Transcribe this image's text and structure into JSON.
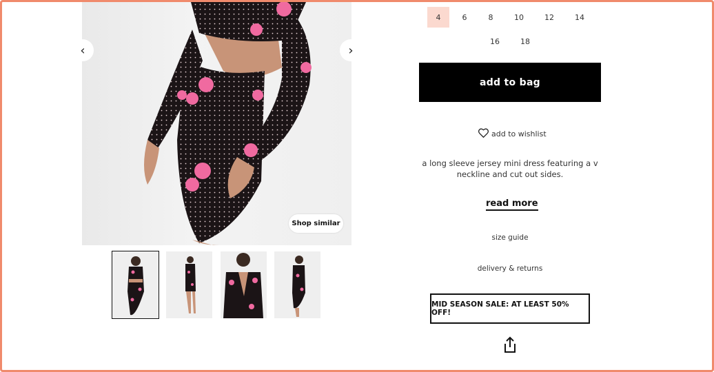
{
  "gallery": {
    "prev_icon": "chevron-left-icon",
    "next_icon": "chevron-right-icon",
    "shop_similar_label": "Shop similar",
    "thumbnails": [
      "thumbnail-1",
      "thumbnail-2",
      "thumbnail-3",
      "thumbnail-4"
    ]
  },
  "sizes": [
    "4",
    "6",
    "8",
    "10",
    "12",
    "14",
    "16",
    "18"
  ],
  "selected_size": "4",
  "add_to_bag_label": "add to bag",
  "wishlist_label": "add to wishlist",
  "description": "a long sleeve jersey mini dress featuring a v neckline and cut out sides.",
  "read_more_label": "read more",
  "size_guide_label": "size guide",
  "delivery_label": "delivery & returns",
  "promo_text": "MID SEASON SALE: AT LEAST 50% OFF!",
  "share_icon": "share-icon",
  "colors": {
    "accent_border": "#f08a6c",
    "selected_size_bg": "#fbd9cf",
    "button_bg": "#000000"
  }
}
